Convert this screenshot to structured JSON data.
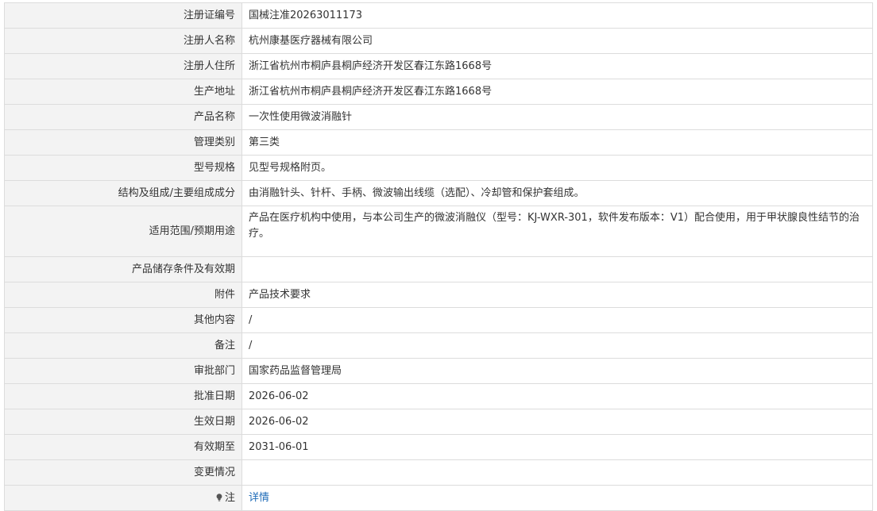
{
  "rows": [
    {
      "label": "注册证编号",
      "value": "国械注准20263011173"
    },
    {
      "label": "注册人名称",
      "value": "杭州康基医疗器械有限公司"
    },
    {
      "label": "注册人住所",
      "value": "浙江省杭州市桐庐县桐庐经济开发区春江东路1668号"
    },
    {
      "label": "生产地址",
      "value": "浙江省杭州市桐庐县桐庐经济开发区春江东路1668号"
    },
    {
      "label": "产品名称",
      "value": "一次性使用微波消融针"
    },
    {
      "label": "管理类别",
      "value": "第三类"
    },
    {
      "label": "型号规格",
      "value": "见型号规格附页。"
    },
    {
      "label": "结构及组成/主要组成成分",
      "value": "由消融针头、针杆、手柄、微波输出线缆（选配）、冷却管和保护套组成。"
    },
    {
      "label": "适用范围/预期用途",
      "value": "产品在医疗机构中使用，与本公司生产的微波消融仪（型号：KJ-WXR-301，软件发布版本：V1）配合使用，用于甲状腺良性结节的治疗。"
    },
    {
      "label": "产品储存条件及有效期",
      "value": ""
    },
    {
      "label": "附件",
      "value": "产品技术要求"
    },
    {
      "label": "其他内容",
      "value": "/"
    },
    {
      "label": "备注",
      "value": "/"
    },
    {
      "label": "审批部门",
      "value": "国家药品监督管理局"
    },
    {
      "label": "批准日期",
      "value": "2026-06-02"
    },
    {
      "label": "生效日期",
      "value": "2026-06-02"
    },
    {
      "label": "有效期至",
      "value": "2031-06-01"
    },
    {
      "label": "变更情况",
      "value": ""
    }
  ],
  "note": {
    "label": "注",
    "link_text": "详情",
    "icon": "lightbulb-icon"
  },
  "colors": {
    "label_bg": "#f3f3f3",
    "border": "#dcdcdc",
    "link": "#1e6bb8"
  }
}
